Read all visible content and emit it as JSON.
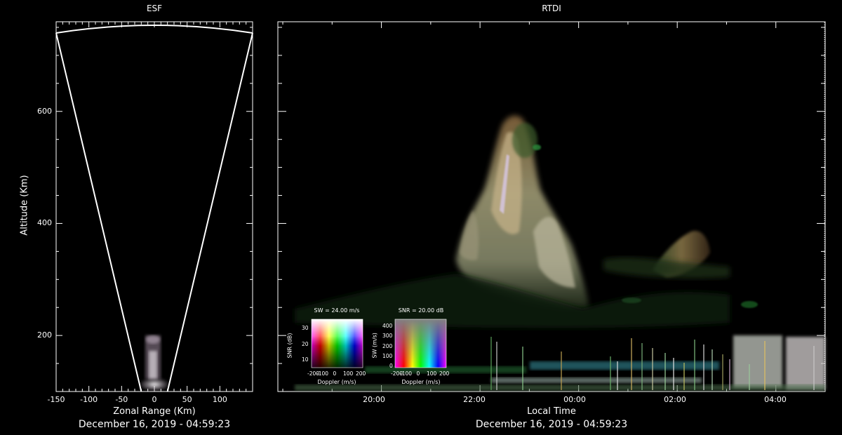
{
  "esf": {
    "title": "ESF",
    "xlabel": "Zonal Range (Km)",
    "ylabel": "Altitude (Km)",
    "date": "December 16, 2019 - 04:59:23",
    "xticks": [
      "-150",
      "-100",
      "-50",
      "0",
      "50",
      "100"
    ],
    "yticks": [
      "600",
      "400",
      "200"
    ]
  },
  "rtdi": {
    "title": "RTDI",
    "xlabel": "Local Time",
    "date": "December 16, 2019 - 04:59:23",
    "xticks": [
      "20:00",
      "22:00",
      "00:00",
      "02:00",
      "04:00"
    ]
  },
  "colorbar_sw": {
    "title": "SW = 24.00 m/s",
    "ylabel": "SNR (dB)",
    "xlabel": "Doppler (m/s)",
    "yticks": [
      "30",
      "20",
      "10"
    ],
    "xticks": [
      "-200",
      "-100",
      "0",
      "100",
      "200"
    ]
  },
  "colorbar_snr": {
    "title": "SNR = 20.00 dB",
    "ylabel": "SW (m/s)",
    "xlabel": "Doppler (m/s)",
    "yticks": [
      "400",
      "300",
      "200",
      "100",
      "0"
    ],
    "xticks": [
      "-200",
      "-100",
      "0",
      "100",
      "200"
    ]
  },
  "chart_data": [
    {
      "type": "scatter",
      "title": "ESF",
      "xlabel": "Zonal Range (Km)",
      "ylabel": "Altitude (Km)",
      "xlim": [
        -150,
        150
      ],
      "ylim": [
        100,
        760
      ],
      "xticks": [
        -150,
        -100,
        -50,
        0,
        50,
        100
      ],
      "yticks": [
        200,
        400,
        600
      ],
      "beam_edges_km": [
        [
          -20,
          100,
          -150,
          740
        ],
        [
          20,
          100,
          150,
          740
        ]
      ],
      "echo_region": {
        "x_range": [
          -20,
          20
        ],
        "alt_range": [
          105,
          200
        ]
      }
    },
    {
      "type": "heatmap",
      "title": "RTDI",
      "xlabel": "Local Time",
      "ylabel": "Altitude (Km)",
      "ylim": [
        100,
        760
      ],
      "x_hours": [
        18.1,
        5.0
      ],
      "xticks": [
        "20:00",
        "22:00",
        "00:00",
        "02:00",
        "04:00"
      ],
      "features": [
        {
          "name": "plume",
          "time_h": [
            21.8,
            23.6
          ],
          "alt": [
            280,
            595
          ]
        },
        {
          "name": "secondary plume",
          "time_h": [
            1.7,
            2.9
          ],
          "alt": [
            280,
            360
          ]
        },
        {
          "name": "bottom layer",
          "time_h": [
            18.3,
            5.0
          ],
          "alt": [
            100,
            160
          ]
        }
      ]
    }
  ],
  "colors": {
    "background": "#000000",
    "axis": "#ffffff"
  }
}
